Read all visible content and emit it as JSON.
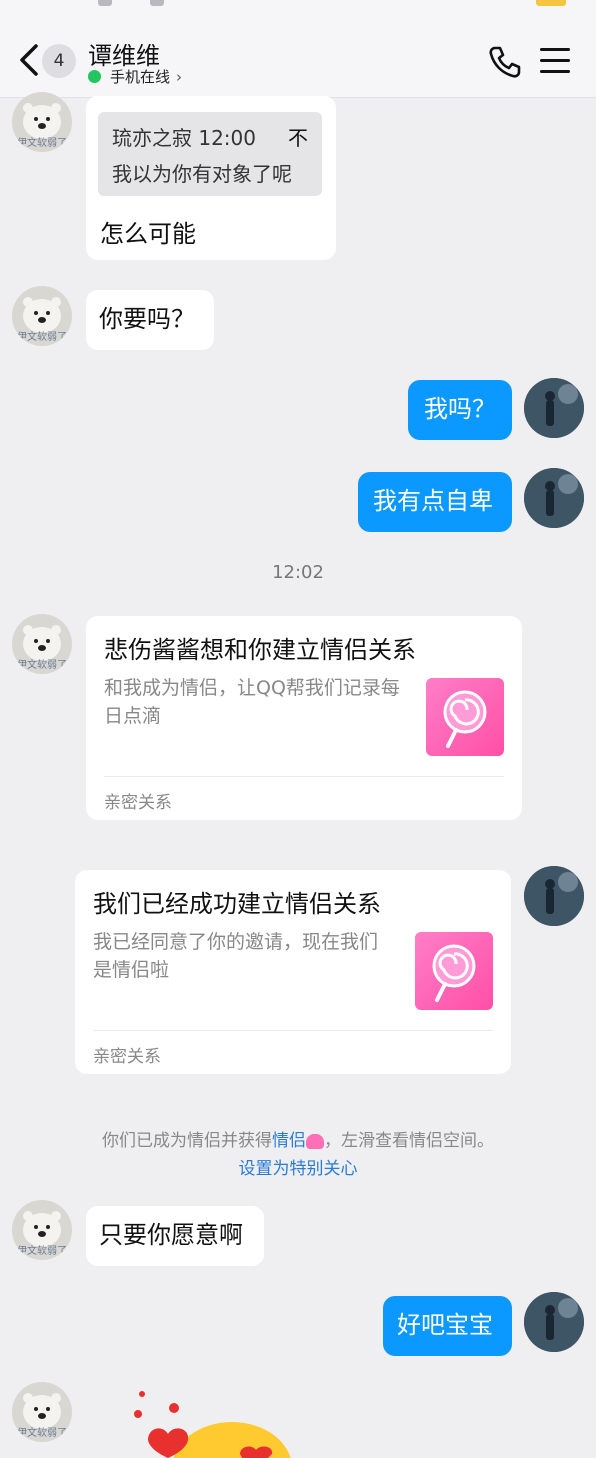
{
  "header": {
    "unread_count": "4",
    "contact_name": "谭维维",
    "status": "手机在线",
    "status_chevron": "›"
  },
  "avatars": {
    "left_label": "伊文软弱了"
  },
  "messages": {
    "quote": {
      "sender": "琉亦之寂 12:00",
      "arrow": "不",
      "text": "我以为你有对象了呢"
    },
    "m1": "怎么可能",
    "m2": "你要吗？",
    "m3": "我吗？",
    "m4": "我有点自卑",
    "time_divider": "12:02",
    "card1": {
      "title": "悲伤酱酱想和你建立情侣关系",
      "desc": "和我成为情侣，让QQ帮我们记录每日点滴",
      "foot": "亲密关系"
    },
    "card2": {
      "title": "我们已经成功建立情侣关系",
      "desc": "我已经同意了你的邀请，现在我们是情侣啦",
      "foot": "亲密关系"
    },
    "system": {
      "line1_prefix": "你们已成为情侣并获得",
      "line1_link": "情侣",
      "line1_suffix": "，左滑查看情侣空间。",
      "line2": "设置为特别关心"
    },
    "m5": "只要你愿意啊",
    "m6": "好吧宝宝"
  },
  "colors": {
    "background": "#efeff1",
    "sent_bubble": "#0b99ff",
    "online": "#22c55e",
    "link": "#2a7bd8"
  }
}
